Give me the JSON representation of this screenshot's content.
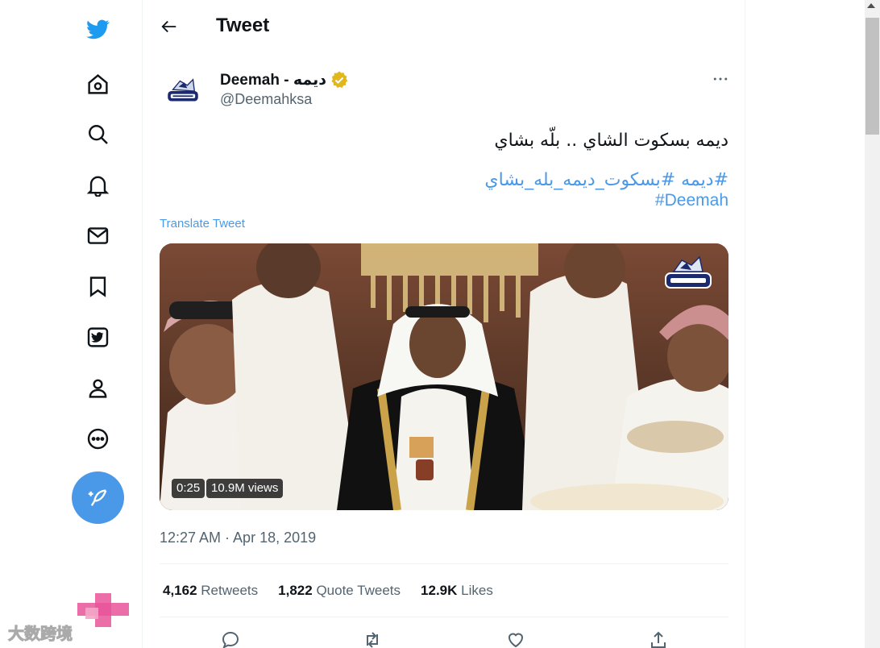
{
  "header": {
    "title": "Tweet"
  },
  "sidebar": {
    "items": [
      {
        "icon": "twitter-logo"
      },
      {
        "icon": "home-icon"
      },
      {
        "icon": "search-icon"
      },
      {
        "icon": "bell-icon"
      },
      {
        "icon": "mail-icon"
      },
      {
        "icon": "bookmark-icon"
      },
      {
        "icon": "twitter-lists-icon"
      },
      {
        "icon": "profile-icon"
      },
      {
        "icon": "more-circle-icon"
      }
    ],
    "compose_icon": "compose-icon"
  },
  "tweet": {
    "author_name": "Deemah - ديمه",
    "author_handle": "@Deemahksa",
    "text": "ديمه بسكوت الشاي .. بلّه بشاي",
    "hashtags_ar": "#ديمه #بسكوت_ديمه_بله_بشاي",
    "hashtag_en": "#Deemah",
    "translate_label": "Translate Tweet",
    "video_duration": "0:25",
    "video_views": "10.9M views",
    "timestamp": "12:27 AM · Apr 18, 2019"
  },
  "stats": {
    "retweets_count": "4,162",
    "retweets_label": "Retweets",
    "quotes_count": "1,822",
    "quotes_label": "Quote Tweets",
    "likes_count": "12.9K",
    "likes_label": "Likes"
  },
  "colors": {
    "accent": "#4a99e9",
    "text": "#0f1419",
    "muted": "#536471",
    "verified": "#e2b719"
  },
  "watermark": "大数跨境"
}
